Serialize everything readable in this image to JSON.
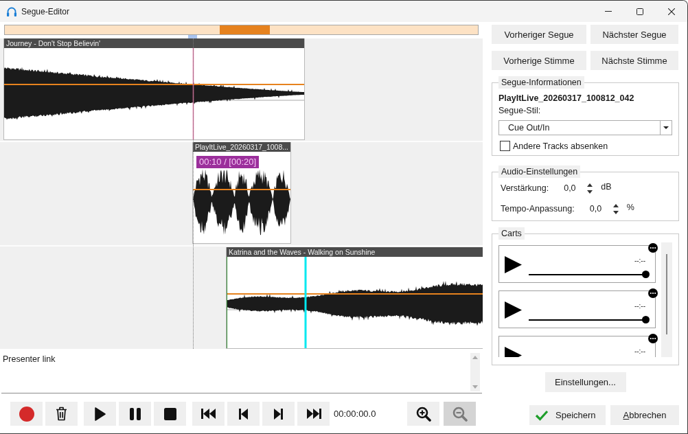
{
  "window": {
    "title": "Segue-Editor"
  },
  "timeline": {
    "clips": [
      {
        "kind": "fade_out",
        "title": "Journey - Don't Stop Believin'"
      },
      {
        "kind": "voice",
        "title": "PlayItLive_20260317_1008...",
        "time_label": "00:10 / [00:20]"
      },
      {
        "kind": "fade_in",
        "title": "Katrina and the Waves - Walking on Sunshine"
      }
    ]
  },
  "notes": {
    "value": "Presenter link"
  },
  "toolbar": {
    "buttons": [
      {
        "kind": "record"
      },
      {
        "kind": "delete"
      },
      {
        "kind": "play"
      },
      {
        "kind": "pause"
      },
      {
        "kind": "stop"
      },
      {
        "kind": "skip_to_start"
      },
      {
        "kind": "previous"
      },
      {
        "kind": "next"
      },
      {
        "kind": "skip_to_end"
      }
    ],
    "time": "00:00:00.0",
    "zoom_buttons": [
      {
        "kind": "zoom_in",
        "pressed": false
      },
      {
        "kind": "zoom_out",
        "pressed": true
      }
    ]
  },
  "navigation_buttons": [
    "Vorheriger Segue",
    "Nächster Segue",
    "Vorherige Stimme",
    "Nächste Stimme"
  ],
  "segue_info": {
    "title": "Segue-Informationen",
    "name": "PlayItLive_20260317_100812_042",
    "style_label": "Segue-Stil:",
    "style_value": "Cue Out/In",
    "duck_checkbox": {
      "label": "Andere Tracks absenken",
      "checked": false
    }
  },
  "audio_settings": {
    "title": "Audio-Einstellungen",
    "rows": [
      {
        "label": "Verstärkung:",
        "value": "0,0",
        "unit": "dB"
      },
      {
        "label": "Tempo-Anpassung:",
        "value": "0,0",
        "unit": "%"
      }
    ]
  },
  "carts": {
    "title": "Carts",
    "items": [
      {
        "time": "--:--",
        "level": 1
      },
      {
        "time": "--:--",
        "level": 1
      },
      {
        "time": "--:--"
      }
    ]
  },
  "settings_button": "Einstellungen...",
  "footer_buttons": [
    {
      "kind": "save",
      "label": "Speichern",
      "access_key_underlined": false
    },
    {
      "kind": "cancel",
      "label": "Abbrechen",
      "access_key_underlined": true
    }
  ]
}
